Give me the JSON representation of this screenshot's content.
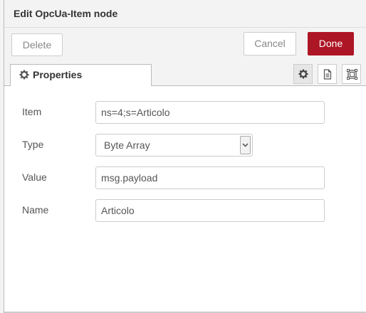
{
  "header": {
    "title": "Edit OpcUa-Item node"
  },
  "toolbar": {
    "delete_label": "Delete",
    "cancel_label": "Cancel",
    "done_label": "Done",
    "done_color": "#ad1625"
  },
  "tabs": {
    "properties_label": "Properties",
    "icons": [
      "gear-icon",
      "document-icon",
      "frame-icon"
    ]
  },
  "form": {
    "item": {
      "label": "Item",
      "value": "ns=4;s=Articolo"
    },
    "type": {
      "label": "Type",
      "value": "Byte Array"
    },
    "value": {
      "label": "Value",
      "value": "msg.payload"
    },
    "name": {
      "label": "Name",
      "value": "Articolo"
    }
  }
}
